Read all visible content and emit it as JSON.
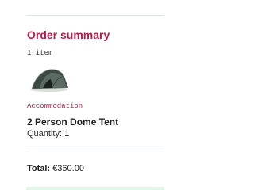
{
  "order_summary": {
    "title": "Order summary",
    "item_count": "1 item",
    "item": {
      "image_icon": "tent-product-image",
      "category": "Accommodation",
      "name": "2 Person Dome Tent",
      "quantity_label": "Quantity:",
      "quantity_value": "1"
    },
    "total_label": "Total:",
    "total_value": "€360.00"
  },
  "colors": {
    "heading": "#b01f4a",
    "divider": "#d8e4e6",
    "button_bg": "#e3f4e8"
  }
}
